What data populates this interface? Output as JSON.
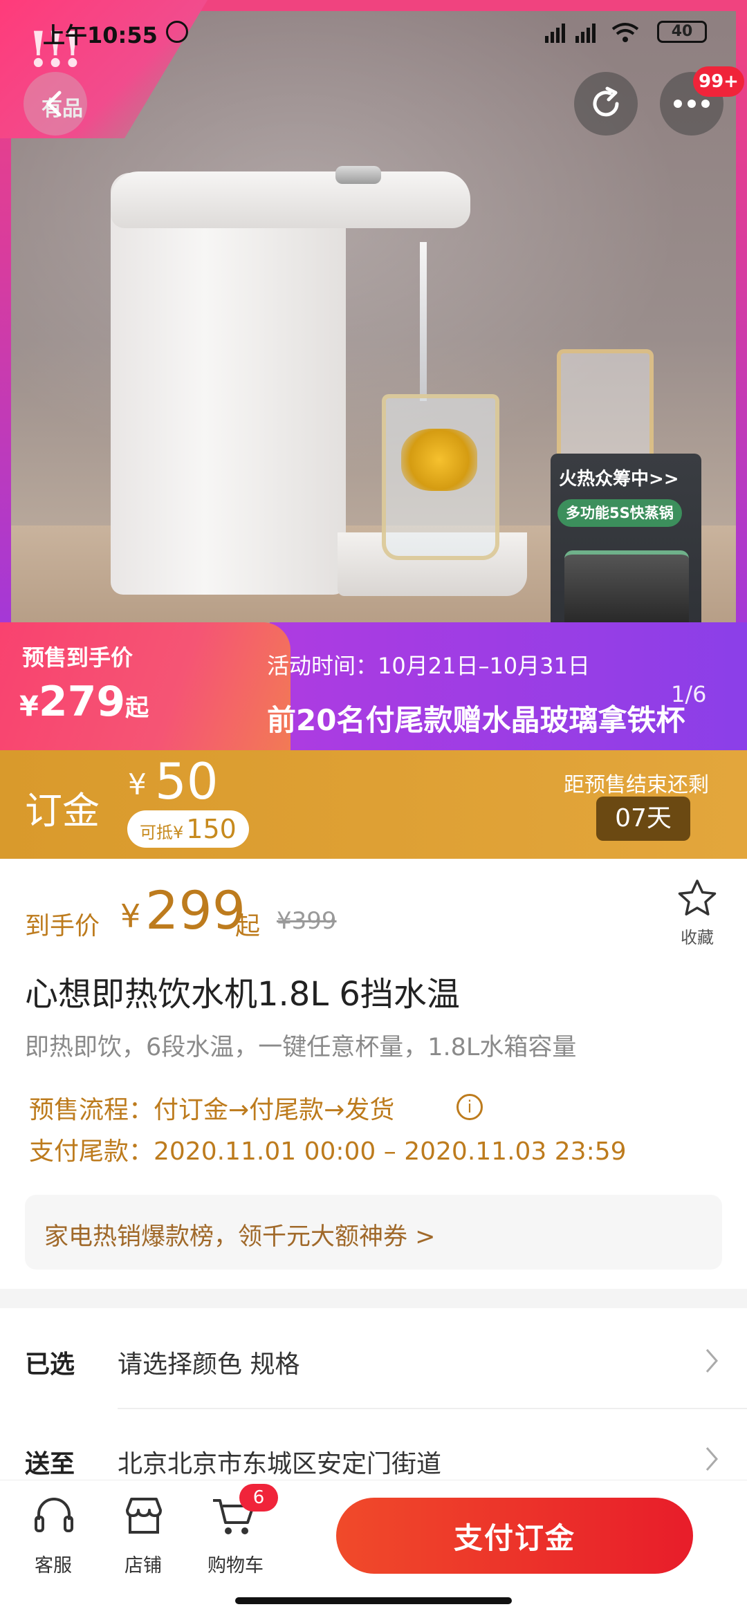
{
  "status_bar": {
    "time": "上午10:55",
    "battery": "40"
  },
  "hero": {
    "corner_brand": "有品",
    "more_badge": "99+",
    "crowdfunding": {
      "title": "火热众筹中>>",
      "pill": "多功能5S快蒸锅"
    },
    "page_indicator": "1/6"
  },
  "presale": {
    "label": "预售到手价",
    "currency": "¥",
    "price": "279",
    "suffix": "起",
    "activity_time": "活动时间：10月21日–10月31日",
    "promo": "前20名付尾款赠水晶玻璃拿铁杯"
  },
  "deposit": {
    "label": "订金",
    "currency": "¥",
    "amount": "50",
    "deduct_prefix": "可抵¥",
    "deduct_amount": "150",
    "remain_label": "距预售结束还剩",
    "remain_days": "07天"
  },
  "price": {
    "label": "到手价",
    "currency": "¥",
    "amount": "299",
    "suffix": "起",
    "original": "¥399",
    "favorite_label": "收藏"
  },
  "product": {
    "title": "心想即热饮水机1.8L 6挡水温",
    "subtitle": "即热即饮，6段水温，一键任意杯量，1.8L水箱容量",
    "presale_flow": "预售流程：付订金→付尾款→发货",
    "final_payment": "支付尾款：2020.11.01 00:00 – 2020.11.03 23:59",
    "coupon_banner": "家电热销爆款榜，领千元大额神券 >"
  },
  "selections": [
    {
      "label": "已选",
      "value": "请选择颜色 规格"
    },
    {
      "label": "送至",
      "value": "北京北京市东城区安定门街道"
    }
  ],
  "bottom_nav": {
    "service": "客服",
    "store": "店铺",
    "cart": "购物车",
    "cart_count": "6",
    "pay_button": "支付订金"
  },
  "colors": {
    "accent_gold": "#bd7b1d",
    "deposit_bar": "#e3a63c",
    "pay_red": "#e81d2a",
    "presale_purple": "#8b3fe8",
    "presale_pink": "#f9426f"
  }
}
